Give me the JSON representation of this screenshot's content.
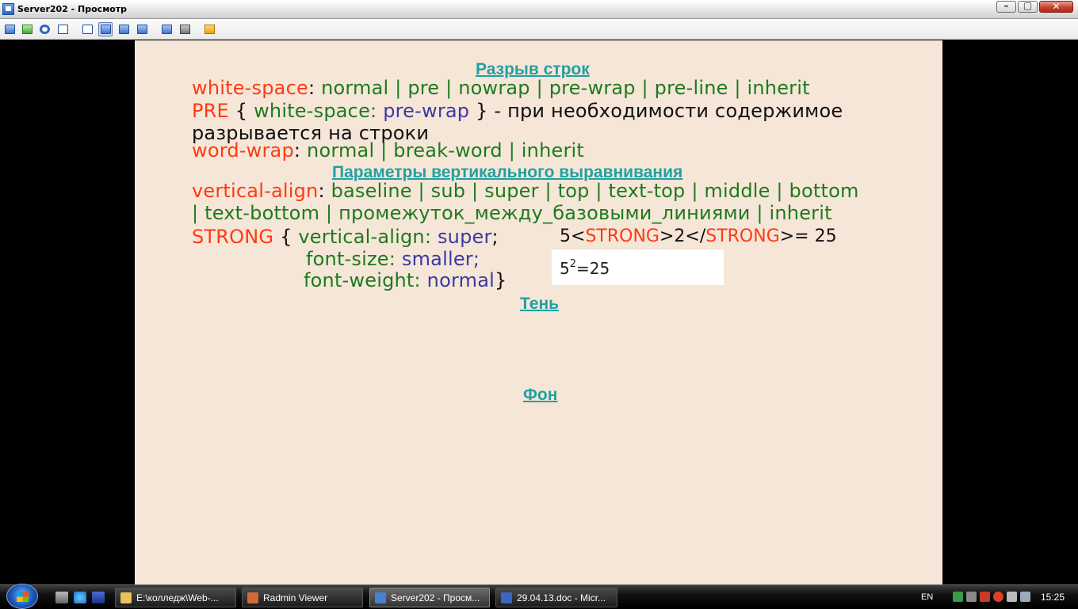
{
  "window": {
    "title": "Server202 - Просмотр",
    "buttons": {
      "minimize": "–",
      "maximize": "▢",
      "close": "✕"
    }
  },
  "toolbar": {
    "icons": [
      "monitor-icon",
      "connect-icon",
      "voice-icon",
      "chat-icon",
      "window-icon",
      "fullscreen-icon",
      "screen-icon",
      "scale-icon",
      "copy-icon",
      "settings-icon",
      "close-session-icon"
    ]
  },
  "slide": {
    "heading_linebreak": "Разрыв строк",
    "ws_line": {
      "prop": "white-space",
      "colon": ":",
      "values": "normal | pre | nowrap | pre-wrap | pre-line | inherit"
    },
    "pre_line": {
      "selector": "PRE",
      "open": "{",
      "prop": "white-space:",
      "value": "pre-wrap",
      "close": "}",
      "desc": "- при необходимости содержимое",
      "desc2": "разрывается на строки"
    },
    "ww_line": {
      "prop": "word-wrap",
      "colon": ":",
      "values": "normal | break-word | inherit"
    },
    "heading_valign": "Параметры вертикального выравнивания",
    "va_line": {
      "prop": "vertical-align",
      "colon": ":",
      "values1": "baseline | sub | super | top | text-top | middle | bottom",
      "values2": "| text-bottom | промежуток_между_базовыми_линиями | inherit"
    },
    "strong_rule": {
      "selector": "STRONG",
      "open": "{",
      "p1": "vertical-align:",
      "v1": "super",
      "s1": ";",
      "p2": "font-size:",
      "v2": "smaller;",
      "p3": "font-weight:",
      "v3": "normal",
      "close": "}"
    },
    "code_sample": {
      "a": "5<",
      "tag1": "STRONG",
      "b": ">2</",
      "tag2": "STRONG",
      "c": ">= 25"
    },
    "rendered": {
      "base": "5",
      "sup": "2",
      "rest": "=25"
    },
    "heading_shadow": "Тень",
    "heading_bg": "Фон"
  },
  "taskbar": {
    "tasks": [
      {
        "label": "E:\\колледж\\Web-...",
        "icon_color": "#e8c25a"
      },
      {
        "label": "Radmin Viewer",
        "icon_color": "#d06a3a"
      },
      {
        "label": "Server202 - Просм...",
        "icon_color": "#4a7fd0"
      },
      {
        "label": "29.04.13.doc - Micr...",
        "icon_color": "#3a66c0"
      }
    ],
    "lang": "EN",
    "time": "15:25"
  }
}
